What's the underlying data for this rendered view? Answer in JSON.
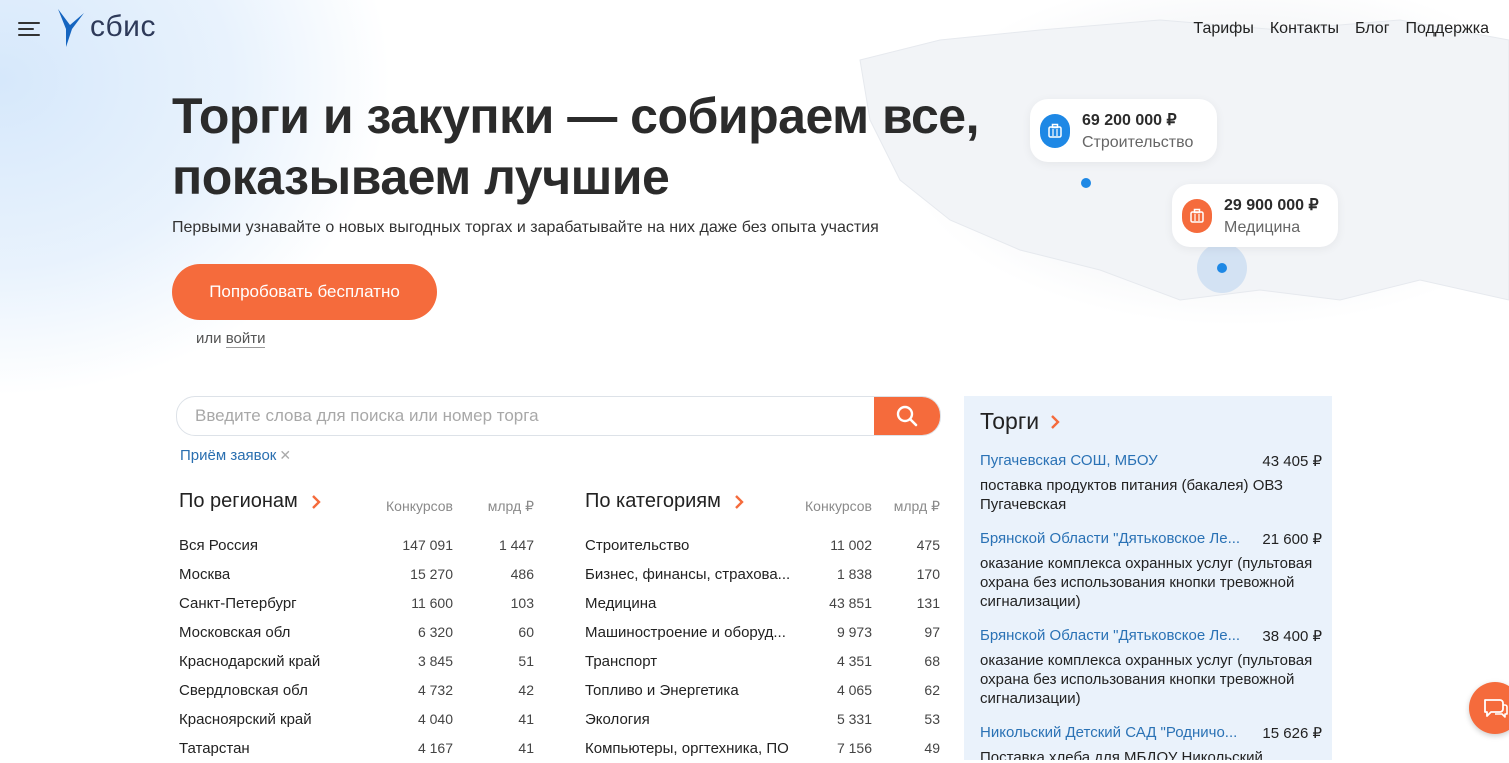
{
  "header": {
    "logo_text": "сбис",
    "nav": [
      "Тарифы",
      "Контакты",
      "Блог",
      "Поддержка"
    ]
  },
  "hero": {
    "title_line1": "Торги и закупки — собираем все,",
    "title_line2": "показываем лучшие",
    "subtitle": "Первыми узнавайте о новых выгодных торгах и зарабатывайте на них даже без опыта участия",
    "cta_label": "Попробовать бесплатно",
    "or_text": "или",
    "login_link": "войти"
  },
  "map_cards": [
    {
      "amount": "69 200 000 ₽",
      "category": "Строительство",
      "color": "#1e88e5",
      "icon": "briefcase-icon"
    },
    {
      "amount": "29 900 000 ₽",
      "category": "Медицина",
      "color": "#f56b3c",
      "icon": "briefcase-icon"
    }
  ],
  "search": {
    "placeholder": "Введите слова для поиска или номер торга",
    "filter_chip": "Приём заявок"
  },
  "regions": {
    "title": "По регионам",
    "col1": "Конкурсов",
    "col2": "млрд ₽",
    "rows": [
      {
        "name": "Вся Россия",
        "count": "147 091",
        "sum": "1 447"
      },
      {
        "name": "Москва",
        "count": "15 270",
        "sum": "486"
      },
      {
        "name": "Санкт-Петербург",
        "count": "11 600",
        "sum": "103"
      },
      {
        "name": "Московская обл",
        "count": "6 320",
        "sum": "60"
      },
      {
        "name": "Краснодарский край",
        "count": "3 845",
        "sum": "51"
      },
      {
        "name": "Свердловская обл",
        "count": "4 732",
        "sum": "42"
      },
      {
        "name": "Красноярский край",
        "count": "4 040",
        "sum": "41"
      },
      {
        "name": "Татарстан",
        "count": "4 167",
        "sum": "41"
      }
    ]
  },
  "categories": {
    "title": "По категориям",
    "col1": "Конкурсов",
    "col2": "млрд ₽",
    "rows": [
      {
        "name": "Строительство",
        "count": "11 002",
        "sum": "475"
      },
      {
        "name": "Бизнес, финансы, страхова...",
        "count": "1 838",
        "sum": "170"
      },
      {
        "name": "Медицина",
        "count": "43 851",
        "sum": "131"
      },
      {
        "name": "Машиностроение и оборуд...",
        "count": "9 973",
        "sum": "97"
      },
      {
        "name": "Транспорт",
        "count": "4 351",
        "sum": "68"
      },
      {
        "name": "Топливо и Энергетика",
        "count": "4 065",
        "sum": "62"
      },
      {
        "name": "Экология",
        "count": "5 331",
        "sum": "53"
      },
      {
        "name": "Компьютеры, оргтехника, ПО",
        "count": "7 156",
        "sum": "49"
      }
    ]
  },
  "tenders": {
    "title": "Торги",
    "items": [
      {
        "org": "Пугачевская СОШ, МБОУ",
        "price": "43 405 ₽",
        "desc": "поставка продуктов питания (бакалея) ОВЗ Пугачевская"
      },
      {
        "org": "Брянской Области \"Дятьковское Ле...",
        "price": "21 600 ₽",
        "desc": "оказание комплекса охранных услуг (пультовая охрана без использования кнопки тревожной сигнализации)"
      },
      {
        "org": "Брянской Области \"Дятьковское Ле...",
        "price": "38 400 ₽",
        "desc": "оказание комплекса охранных услуг (пультовая охрана без использования кнопки тревожной сигнализации)"
      },
      {
        "org": "Никольский Детский САД \"Родничо...",
        "price": "15 626 ₽",
        "desc": "Поставка хлеба для МБДОУ Никольский"
      }
    ]
  }
}
